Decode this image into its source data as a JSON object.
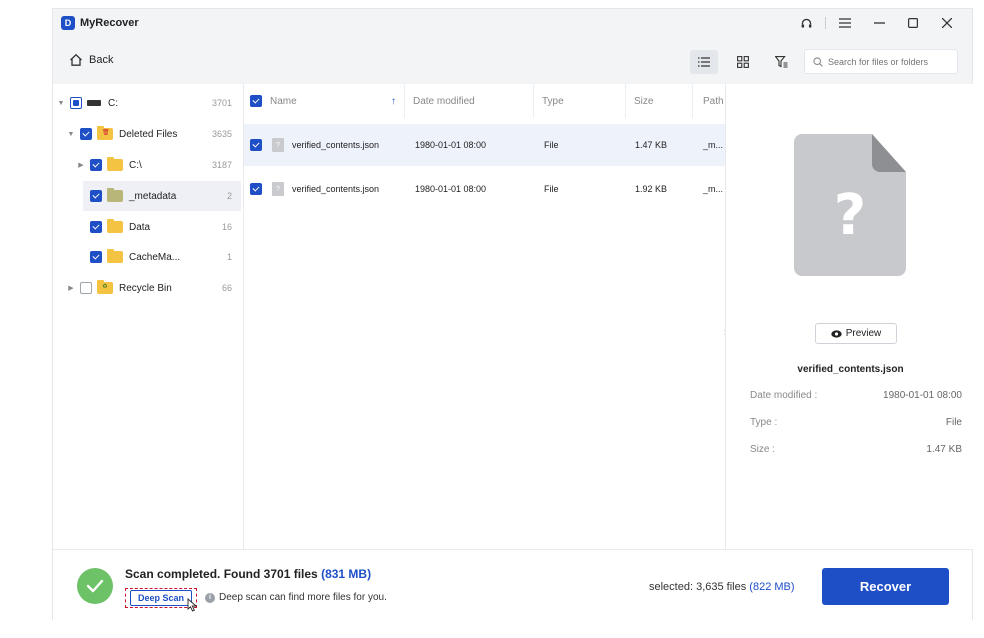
{
  "app": {
    "title": "MyRecover",
    "logo_letter": "D"
  },
  "toolbar": {
    "back_label": "Back",
    "search_placeholder": "Search for files or folders"
  },
  "tree": {
    "items": [
      {
        "label": "C:",
        "count": "3701",
        "state": "partial",
        "icon": "drive-icon"
      },
      {
        "label": "Deleted Files",
        "count": "3635",
        "state": "checked",
        "icon": "trash-folder-icon"
      },
      {
        "label": "C:\\",
        "count": "3187",
        "state": "checked",
        "icon": "folder-icon"
      },
      {
        "label": "_metadata",
        "count": "2",
        "state": "checked",
        "icon": "folder-icon"
      },
      {
        "label": "Data",
        "count": "16",
        "state": "checked",
        "icon": "folder-icon"
      },
      {
        "label": "CacheMa...",
        "count": "1",
        "state": "checked",
        "icon": "folder-icon"
      },
      {
        "label": "Recycle Bin",
        "count": "66",
        "state": "empty",
        "icon": "recycle-folder-icon"
      }
    ]
  },
  "table": {
    "columns": [
      "Name",
      "Date modified",
      "Type",
      "Size",
      "Path"
    ],
    "rows": [
      {
        "name": "verified_contents.json",
        "date": "1980-01-01 08:00",
        "type": "File",
        "size": "1.47 KB",
        "path": "_m..."
      },
      {
        "name": "verified_contents.json",
        "date": "1980-01-01 08:00",
        "type": "File",
        "size": "1.92 KB",
        "path": "_m..."
      }
    ]
  },
  "preview": {
    "button_label": "Preview",
    "file_name": "verified_contents.json",
    "meta": [
      {
        "label": "Date modified :",
        "value": "1980-01-01 08:00"
      },
      {
        "label": "Type :",
        "value": "File"
      },
      {
        "label": "Size :",
        "value": "1.47 KB"
      }
    ]
  },
  "footer": {
    "scan_text": "Scan completed. Found 3701 files",
    "scan_size": "(831 MB)",
    "deep_scan_label": "Deep Scan",
    "deep_scan_hint": "Deep scan can find more files for you.",
    "selected_text": "selected: 3,635 files",
    "selected_size": "(822 MB)",
    "recover_label": "Recover"
  },
  "colors": {
    "accent": "#1f4fc7",
    "success": "#6dc267",
    "highlight_border": "#c8102e"
  }
}
